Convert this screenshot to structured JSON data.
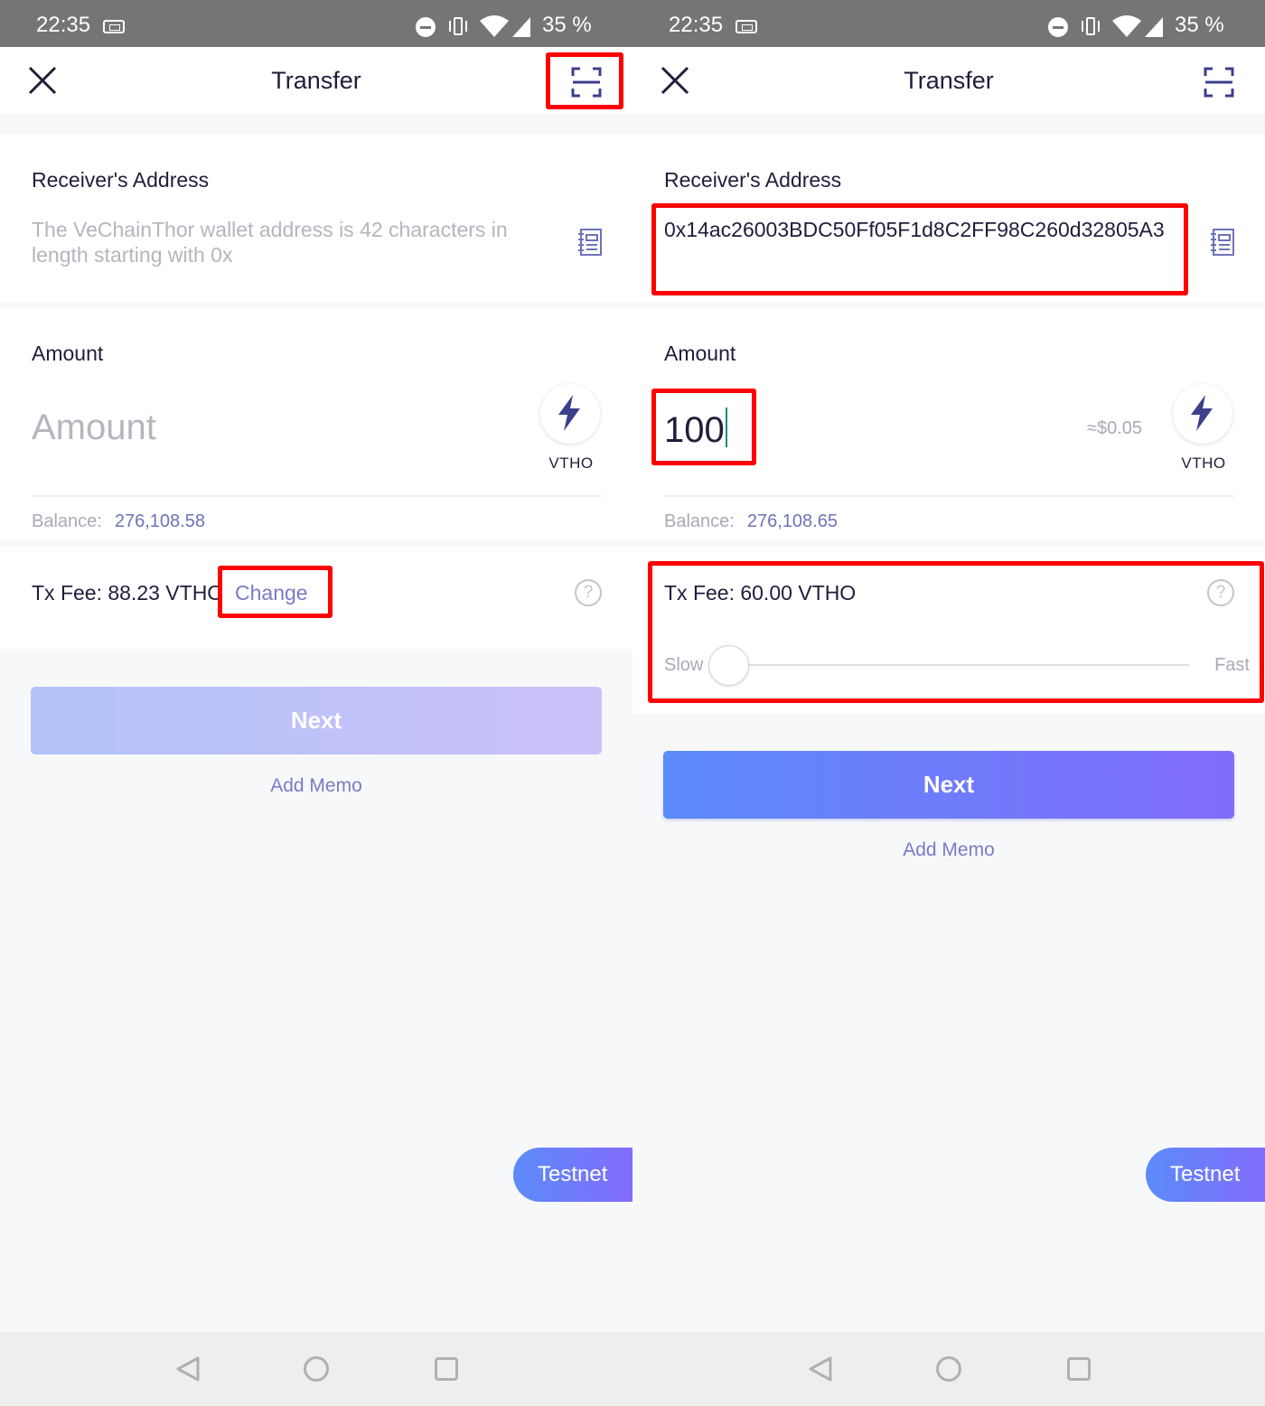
{
  "status_bar": {
    "time": "22:35",
    "battery": "35 %"
  },
  "left": {
    "title": "Transfer",
    "receiver_label": "Receiver's Address",
    "address_placeholder": "The VeChainThor wallet address is 42 characters in length starting with 0x",
    "amount_label": "Amount",
    "amount_placeholder": "Amount",
    "token": "VTHO",
    "balance_label": "Balance:",
    "balance_value": "276,108.58",
    "fee_text": "Tx Fee: 88.23 VTHO",
    "change_label": "Change",
    "next_label": "Next",
    "next_enabled": false,
    "add_memo": "Add Memo",
    "testnet": "Testnet"
  },
  "right": {
    "title": "Transfer",
    "receiver_label": "Receiver's Address",
    "address_value": "0x14ac26003BDC50Ff05F1d8C2FF98C260d32805A3",
    "amount_label": "Amount",
    "amount_value": "100",
    "usd_estimate": "≈$0.05",
    "token": "VTHO",
    "balance_label": "Balance:",
    "balance_value": "276,108.65",
    "fee_text": "Tx Fee: 60.00 VTHO",
    "slider_slow": "Slow",
    "slider_fast": "Fast",
    "fee_slider_level": 0,
    "next_label": "Next",
    "next_enabled": true,
    "add_memo": "Add Memo",
    "testnet": "Testnet"
  },
  "colors": {
    "accent": "#7a7bc6",
    "button_gradient_start": "#5c8bfa",
    "button_gradient_end": "#826cfc",
    "highlight": "#ff0000",
    "status_bar": "#757575"
  },
  "icons": [
    "close-icon",
    "scan-icon",
    "address-book-icon",
    "bolt-icon",
    "help-icon",
    "nav-back-icon",
    "nav-home-icon",
    "nav-recent-icon"
  ]
}
